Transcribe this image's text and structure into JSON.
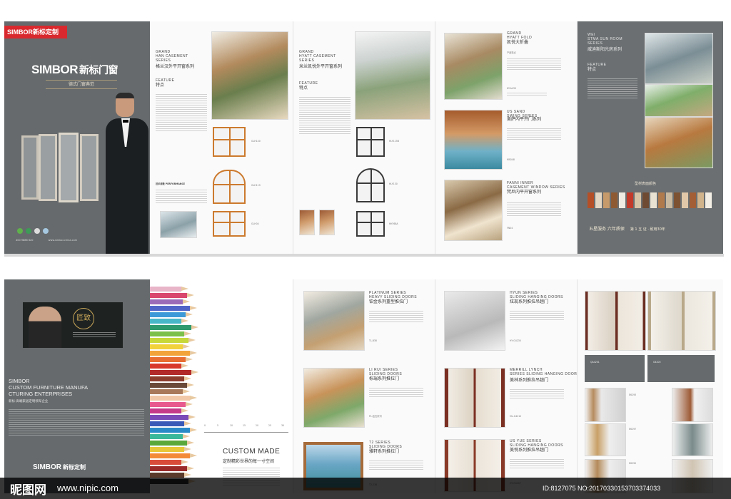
{
  "top": {
    "cover": {
      "brand_badge": "SIMBOR新标定制",
      "logo_text": "SIMBOR",
      "brand_cn": "新标门窗",
      "slogan": "德式门窗典范",
      "contact_phone": "400 9886 620",
      "contact_web": "www.simbor-china.com"
    },
    "grand_han": {
      "series_en": "GRAND\nHAN CASEMENT\nSERIES",
      "series_cn": "格兰汉外平开窗系列",
      "feature_en": "FEATURE",
      "feature_cn": "特点",
      "models": [
        "GLH140",
        "GLH119",
        "GLH04"
      ],
      "spec_caption": "技术参数 PERFORMANCE"
    },
    "grand_hyatt": {
      "series_en": "GRAND\nHYATT CASEMENT\nSERIES",
      "series_cn": "米兰凯悦外平开窗系列",
      "feature_en": "FEATURE",
      "feature_cn": "特点",
      "models": [
        "HLY115B",
        "HLY130",
        "HKY68A"
      ]
    },
    "hyatt_fold": {
      "series_en": "GRAND\nHYATT FOLD",
      "series_cn": "凯悦大折叠",
      "model": "KY-A430",
      "features_title": "产品特点"
    },
    "us_sand": {
      "series_en": "US SAND\nSWING SERIES",
      "series_cn": "美萨内平开门系列",
      "model": "MS048"
    },
    "fanni": {
      "series_en": "FANNI INNER\nCASEMENT WINDOW SERIES",
      "series_cn": "梵尼内平开窗系列",
      "model": "FN04"
    },
    "sunroom": {
      "series_en": "WEI\nSTMA SUN ROOM\nSERIES",
      "series_cn": "威迪斯阳光房系列",
      "feature_en": "FEATURE",
      "feature_cn": "特点",
      "colors_title": "型材表面颜色",
      "service": "五星服务  六年质保",
      "warranty": "第 1 五 证 · 耐用30年"
    }
  },
  "bottom": {
    "intro": {
      "company_en": "SIMBOR\nCUSTOM FURNITURE MANUFA\nCTURING ENTERPRISES",
      "company_cn": "新标·高端家居定制领军企业",
      "craft": "匠致",
      "logo_text": "SIMBOR",
      "brand_cn": "新标定制"
    },
    "custom": {
      "title_en": "CUSTOM MADE",
      "title_cn": "定制精彩世界的每一寸空间",
      "ruler_labels": [
        "0",
        "5",
        "10",
        "15",
        "20",
        "25",
        "30"
      ]
    },
    "sliding_a": [
      {
        "series_en": "PLATINUM SERIES\nHEAVY SLIDING DOORS",
        "series_cn": "铂金系列重型推拉门",
        "model": "TL-B38"
      },
      {
        "series_en": "LI RUI SERIES\nSLIDING DOORS",
        "series_cn": "栎瑞系列推拉门",
        "model": "PL-钻石系列"
      },
      {
        "series_en": "T2 SERIES\nSLIDING DOORS",
        "series_cn": "雅轩系列推拉门",
        "model": "T2-238"
      }
    ],
    "sliding_b": [
      {
        "series_en": "HYUN SERIES\nSLIDING HANGING DOORS",
        "series_cn": "炫现系列推拉吊趟门",
        "model": "HY-G4230"
      },
      {
        "series_en": "MERRILL LYNCH\nSERIES SLIDING HANGING DOORS",
        "series_cn": "美林系列推拉吊趟门",
        "model": "ML-G4212"
      },
      {
        "series_en": "US YUE SERIES\nSLIDING HANGING DOORS",
        "series_cn": "美悦系列推拉吊趟门",
        "model": "HY-G4207"
      }
    ],
    "hinged": {
      "models_top": [
        "QA4201",
        "G4203"
      ],
      "models": [
        "E6293",
        "E6297",
        "E6290"
      ]
    }
  },
  "watermark": {
    "site_cn": "昵图网",
    "url": "www.nipic.com",
    "id": "ID:8127075 NO:20170330153703374033"
  },
  "colors": {
    "panel_dark": "#666a6c",
    "brand_red": "#d9292e",
    "frame_orange": "#cc7a2e"
  }
}
